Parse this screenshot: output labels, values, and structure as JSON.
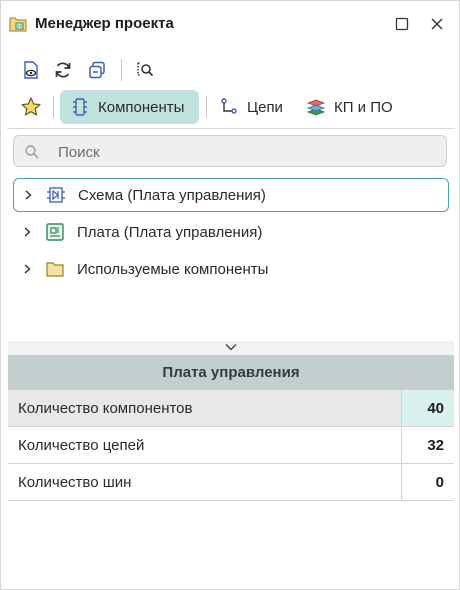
{
  "window": {
    "title": "Менеджер проекта"
  },
  "toolbar": {
    "buttons": [
      "document-view-icon",
      "refresh-icon",
      "copy-icon",
      "search-list-icon"
    ]
  },
  "tabs": [
    {
      "label": "Компоненты",
      "icon": "component-icon",
      "active": true
    },
    {
      "label": "Цепи",
      "icon": "net-icon",
      "active": false
    },
    {
      "label": "КП и ПО",
      "icon": "layers-icon",
      "active": false
    }
  ],
  "search": {
    "placeholder": "Поиск"
  },
  "tree": [
    {
      "label": "Схема (Плата управления)",
      "icon": "schematic-icon",
      "selected": true
    },
    {
      "label": "Плата (Плата управления)",
      "icon": "board-icon",
      "selected": false
    },
    {
      "label": "Используемые компоненты",
      "icon": "folder-icon",
      "selected": false
    }
  ],
  "properties": {
    "header": "Плата управления",
    "rows": [
      {
        "key": "Количество компонентов",
        "value": "40"
      },
      {
        "key": "Количество цепей",
        "value": "32"
      },
      {
        "key": "Количество шин",
        "value": "0"
      }
    ]
  },
  "colors": {
    "accent": "#4aa7a0",
    "active_tab": "#bfe2de",
    "header_bg": "#c3cfce"
  }
}
